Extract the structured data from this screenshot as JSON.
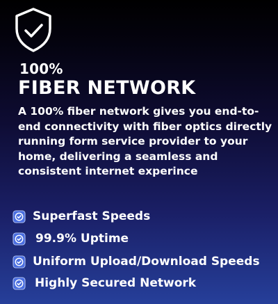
{
  "header": {
    "eyebrow": "100%",
    "title": "FIBER NETWORK"
  },
  "description": "A 100%  fiber network gives you end-to-end connectivity with fiber optics directly running form service provider to your home, delivering a seamless and consistent internet experince",
  "features": [
    {
      "label": "Superfast Speeds",
      "icon": "check-badge-icon"
    },
    {
      "label": "99.9% Uptime",
      "icon": "check-badge-icon"
    },
    {
      "label": "Uniform Upload/Download Speeds",
      "icon": "check-badge-icon"
    },
    {
      "label": "Highly Secured Network",
      "icon": "check-badge-icon"
    }
  ],
  "colors": {
    "text": "#ffffff",
    "background_top": "#000000",
    "background_bottom": "#263f9a",
    "badge_fill": "#4a6ee0"
  }
}
